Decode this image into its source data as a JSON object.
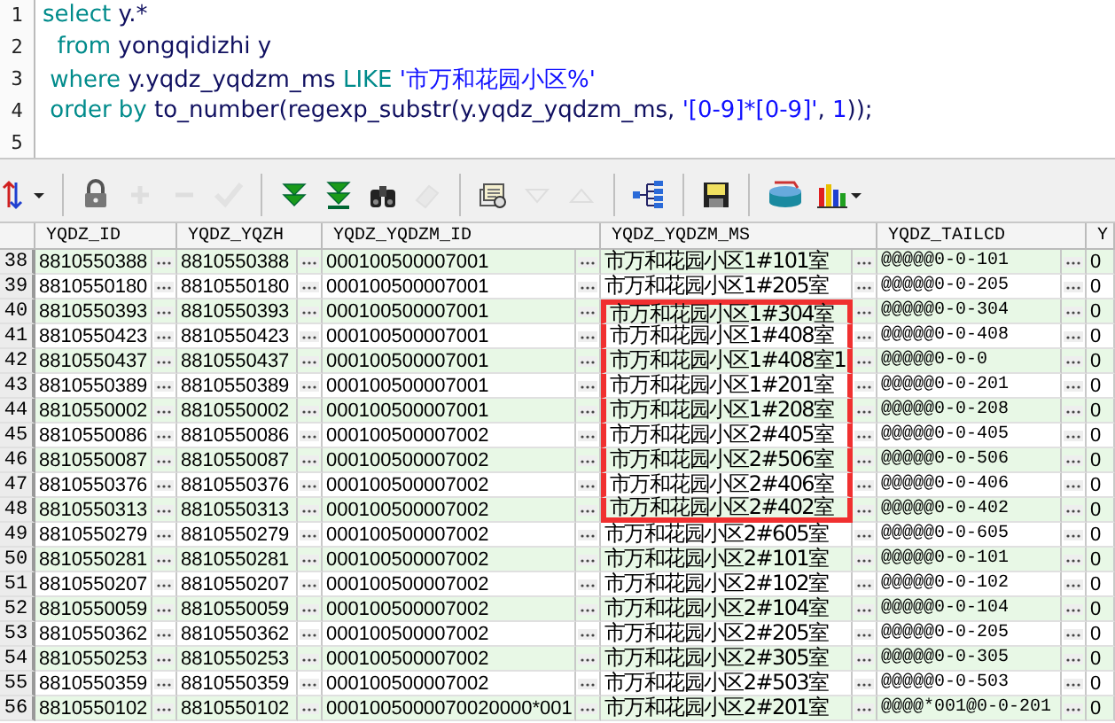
{
  "editor": {
    "lines": [
      {
        "number": "1",
        "tokens": [
          {
            "kind": "keyword",
            "text": "select"
          },
          {
            "kind": "ident",
            "text": " y.*"
          }
        ]
      },
      {
        "number": "2",
        "tokens": [
          {
            "kind": "keyword",
            "text": "  from"
          },
          {
            "kind": "ident",
            "text": " yongqidizhi y"
          }
        ]
      },
      {
        "number": "3",
        "tokens": [
          {
            "kind": "keyword",
            "text": " where"
          },
          {
            "kind": "ident",
            "text": " y.yqdz_yqdzm_ms "
          },
          {
            "kind": "keyword",
            "text": "LIKE"
          },
          {
            "kind": "string",
            "text": " '市万和花园小区%'"
          }
        ]
      },
      {
        "number": "4",
        "tokens": [
          {
            "kind": "keyword",
            "text": " order by"
          },
          {
            "kind": "ident",
            "text": " to_number(regexp_substr(y.yqdz_yqdzm_ms, "
          },
          {
            "kind": "string",
            "text": "'[0-9]*[0-9]'"
          },
          {
            "kind": "ident",
            "text": ", "
          },
          {
            "kind": "string",
            "text": "1"
          },
          {
            "kind": "ident",
            "text": "));"
          }
        ]
      },
      {
        "number": "5"
      }
    ]
  },
  "toolbar": [
    [
      {
        "kind": "sort",
        "disabled": false
      }
    ],
    [
      {
        "kind": "lock",
        "disabled": false
      },
      {
        "kind": "add",
        "disabled": true
      },
      {
        "kind": "remove",
        "disabled": true
      },
      {
        "kind": "post",
        "disabled": true
      }
    ],
    [
      {
        "kind": "next",
        "disabled": false
      },
      {
        "kind": "last",
        "disabled": false
      },
      {
        "kind": "find",
        "disabled": false
      },
      {
        "kind": "clear",
        "disabled": true
      }
    ],
    [
      {
        "kind": "query",
        "disabled": false
      },
      {
        "kind": "down",
        "disabled": true
      },
      {
        "kind": "up",
        "disabled": true
      }
    ],
    [
      {
        "kind": "tree",
        "disabled": false
      }
    ],
    [
      {
        "kind": "save",
        "disabled": false
      }
    ],
    [
      {
        "kind": "export",
        "disabled": false
      },
      {
        "kind": "chart",
        "disabled": false
      }
    ]
  ],
  "table": {
    "columns": [
      "YQDZ_ID",
      "YQDZ_YQZH",
      "YQDZ_YQDZM_ID",
      "YQDZ_YQDZM_MS",
      "YQDZ_TAILCD",
      "Y"
    ],
    "rows": [
      {
        "number": "38",
        "boxed": false,
        "cells": [
          "8810550388",
          "8810550388",
          "000100500007001",
          "市万和花园小区1#101室",
          "@@@@@0-0-101",
          "0"
        ]
      },
      {
        "number": "39",
        "boxed": false,
        "cells": [
          "8810550180",
          "8810550180",
          "000100500007001",
          "市万和花园小区1#205室",
          "@@@@@0-0-205",
          "0"
        ]
      },
      {
        "number": "40",
        "boxed": true,
        "cells": [
          "8810550393",
          "8810550393",
          "000100500007001",
          "市万和花园小区1#304室",
          "@@@@@0-0-304",
          "0"
        ]
      },
      {
        "number": "41",
        "boxed": true,
        "cells": [
          "8810550423",
          "8810550423",
          "000100500007001",
          "市万和花园小区1#408室",
          "@@@@@0-0-408",
          "0"
        ]
      },
      {
        "number": "42",
        "boxed": true,
        "cells": [
          "8810550437",
          "8810550437",
          "000100500007001",
          "市万和花园小区1#408室1",
          "@@@@@0-0-0",
          "0"
        ]
      },
      {
        "number": "43",
        "boxed": true,
        "cells": [
          "8810550389",
          "8810550389",
          "000100500007001",
          "市万和花园小区1#201室",
          "@@@@@0-0-201",
          "0"
        ]
      },
      {
        "number": "44",
        "boxed": true,
        "cells": [
          "8810550002",
          "8810550002",
          "000100500007001",
          "市万和花园小区1#208室",
          "@@@@@0-0-208",
          "0"
        ]
      },
      {
        "number": "45",
        "boxed": true,
        "cells": [
          "8810550086",
          "8810550086",
          "000100500007002",
          "市万和花园小区2#405室",
          "@@@@@0-0-405",
          "0"
        ]
      },
      {
        "number": "46",
        "boxed": true,
        "cells": [
          "8810550087",
          "8810550087",
          "000100500007002",
          "市万和花园小区2#506室",
          "@@@@@0-0-506",
          "0"
        ]
      },
      {
        "number": "47",
        "boxed": true,
        "cells": [
          "8810550376",
          "8810550376",
          "000100500007002",
          "市万和花园小区2#406室",
          "@@@@@0-0-406",
          "0"
        ]
      },
      {
        "number": "48",
        "boxed": true,
        "cells": [
          "8810550313",
          "8810550313",
          "000100500007002",
          "市万和花园小区2#402室",
          "@@@@@0-0-402",
          "0"
        ]
      },
      {
        "number": "49",
        "boxed": false,
        "cells": [
          "8810550279",
          "8810550279",
          "000100500007002",
          "市万和花园小区2#605室",
          "@@@@@0-0-605",
          "0"
        ]
      },
      {
        "number": "50",
        "boxed": false,
        "cells": [
          "8810550281",
          "8810550281",
          "000100500007002",
          "市万和花园小区2#101室",
          "@@@@@0-0-101",
          "0"
        ]
      },
      {
        "number": "51",
        "boxed": false,
        "cells": [
          "8810550207",
          "8810550207",
          "000100500007002",
          "市万和花园小区2#102室",
          "@@@@@0-0-102",
          "0"
        ]
      },
      {
        "number": "52",
        "boxed": false,
        "cells": [
          "8810550059",
          "8810550059",
          "000100500007002",
          "市万和花园小区2#104室",
          "@@@@@0-0-104",
          "0"
        ]
      },
      {
        "number": "53",
        "boxed": false,
        "cells": [
          "8810550362",
          "8810550362",
          "000100500007002",
          "市万和花园小区2#205室",
          "@@@@@0-0-205",
          "0"
        ]
      },
      {
        "number": "54",
        "boxed": false,
        "cells": [
          "8810550253",
          "8810550253",
          "000100500007002",
          "市万和花园小区2#305室",
          "@@@@@0-0-305",
          "0"
        ]
      },
      {
        "number": "55",
        "boxed": false,
        "cells": [
          "8810550359",
          "8810550359",
          "000100500007002",
          "市万和花园小区2#503室",
          "@@@@@0-0-503",
          "0"
        ]
      },
      {
        "number": "56",
        "boxed": false,
        "cells": [
          "8810550102",
          "8810550102",
          "0001005000070020000*001",
          "市万和花园小区2#201室",
          "@@@@*001@0-0-201",
          "0"
        ]
      }
    ]
  }
}
